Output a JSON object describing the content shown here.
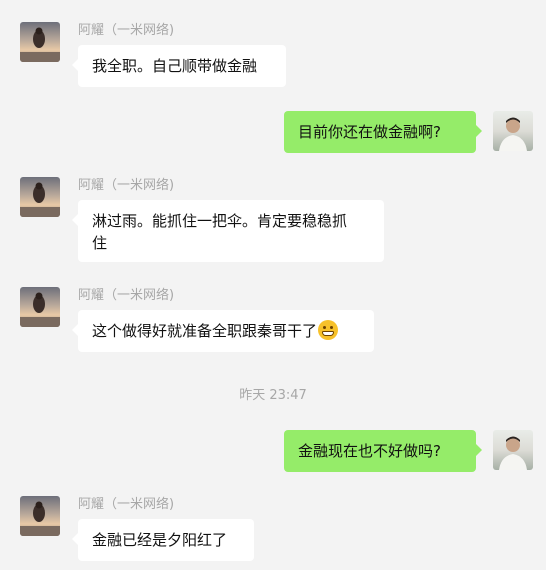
{
  "colors": {
    "background": "#f3f3f3",
    "incoming_bubble": "#ffffff",
    "outgoing_bubble": "#95ec69",
    "name_text": "#a7a7a7"
  },
  "messages": [
    {
      "direction": "in",
      "sender": "阿耀（一米网络)",
      "text": "我全职。自己顺带做金融"
    },
    {
      "direction": "out",
      "text": "目前你还在做金融啊?"
    },
    {
      "direction": "in",
      "sender": "阿耀（一米网络)",
      "text_line1": "淋过雨。能抓住一把伞。肯定要稳稳抓",
      "text_line2": "住"
    },
    {
      "direction": "in",
      "sender": "阿耀（一米网络)",
      "text": "这个做得好就准备全职跟秦哥干了",
      "emoji": "grinning-face-icon"
    },
    {
      "type": "timestamp",
      "text": "昨天 23:47"
    },
    {
      "direction": "out",
      "text": "金融现在也不好做吗?"
    },
    {
      "direction": "in",
      "sender": "阿耀（一米网络)",
      "text": "金融已经是夕阳红了"
    }
  ]
}
